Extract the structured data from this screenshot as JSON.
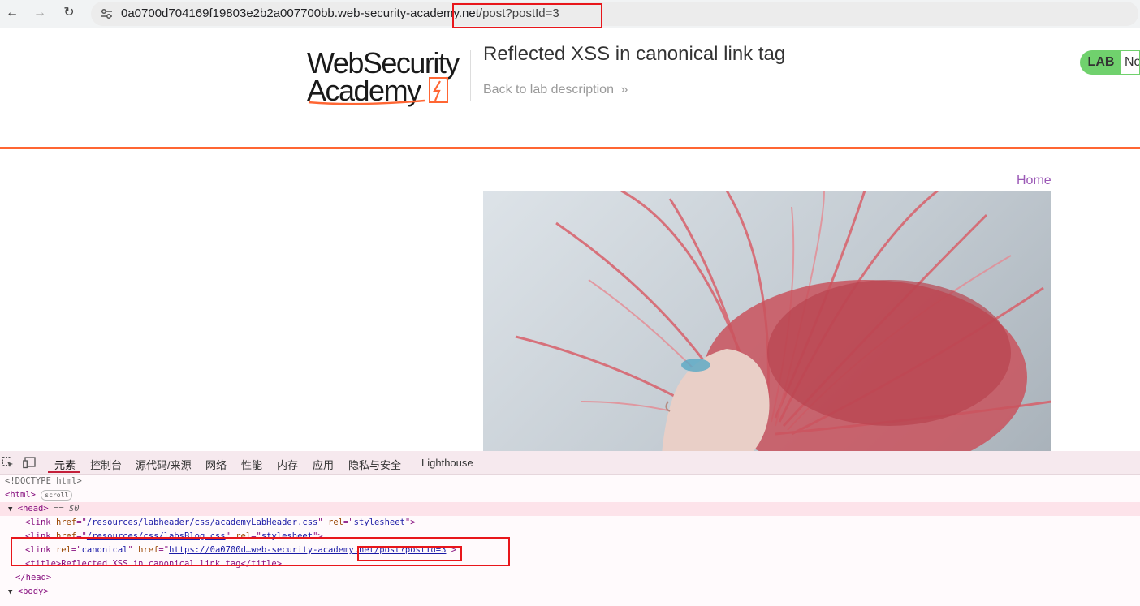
{
  "browser": {
    "url_host": "0a0700d704169f19803e2b2a007700bb.web-security-academy.net",
    "url_path": "/post?postId=3"
  },
  "header": {
    "logo_line1": "WebSecurity",
    "logo_line2": "Academy",
    "lab_title": "Reflected XSS in canonical link tag",
    "back_link": "Back to lab description",
    "lab_badge": "LAB",
    "lab_status": "Not solved"
  },
  "blog": {
    "home_link": "Home"
  },
  "devtools": {
    "tabs": [
      "元素",
      "控制台",
      "源代码/来源",
      "网络",
      "性能",
      "内存",
      "应用",
      "隐私与安全",
      "Lighthouse"
    ],
    "lines": {
      "doctype": "<!DOCTYPE html>",
      "html_open": "<html>",
      "scroll_badge": "scroll",
      "head_open": "<head>",
      "head_marker": "== $0",
      "link1_href": "/resources/labheader/css/academyLabHeader.css",
      "link1_rel": "stylesheet",
      "link2_href": "/resources/css/labsBlog.css",
      "link2_rel": "stylesheet",
      "canonical_rel": "canonical",
      "canonical_href": "https://0a0700d…web-security-academy.net/post?postId=3",
      "title_line": "<title>Reflected XSS in canonical link tag</title>",
      "head_close": "</head>",
      "body_open": "<body>"
    }
  },
  "colors": {
    "highlight_box": "#e8161b",
    "accent_orange": "#ff6633",
    "lab_green": "#70d16d",
    "home_link": "#9b59b6"
  }
}
